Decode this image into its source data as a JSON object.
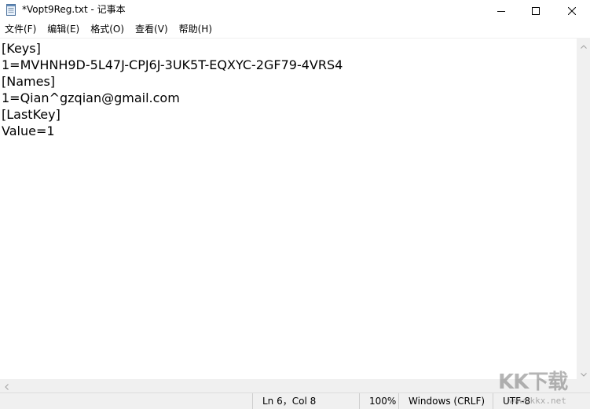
{
  "window": {
    "title": "*Vopt9Reg.txt - 记事本",
    "icon": "notepad-icon",
    "controls": {
      "minimize": "minimize-icon",
      "maximize": "maximize-icon",
      "close": "close-icon"
    }
  },
  "menu": {
    "items": [
      {
        "label": "文件(F)"
      },
      {
        "label": "编辑(E)"
      },
      {
        "label": "格式(O)"
      },
      {
        "label": "查看(V)"
      },
      {
        "label": "帮助(H)"
      }
    ]
  },
  "editor": {
    "lines": [
      "[Keys]",
      "1=MVHNH9D-5L47J-CPJ6J-3UK5T-EQXYC-2GF79-4VRS4",
      "[Names]",
      "1=Qian^gzqian@gmail.com",
      "[LastKey]",
      "Value=1"
    ]
  },
  "statusbar": {
    "position": "Ln 6，Col 8",
    "zoom": "100%",
    "line_ending": "Windows (CRLF)",
    "encoding": "UTF-8"
  },
  "watermark": {
    "logo": "KK下载",
    "url": "www.kkx.net"
  },
  "colors": {
    "chrome_bg": "#f0f0f0",
    "text": "#000000",
    "editor_bg": "#ffffff"
  }
}
